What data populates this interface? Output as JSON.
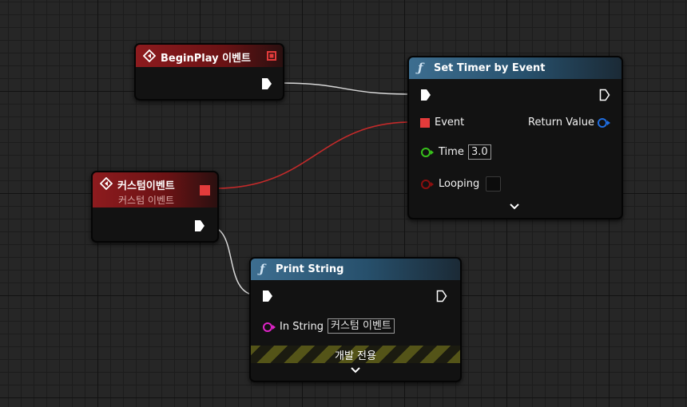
{
  "nodes": {
    "begin_play": {
      "title": "BeginPlay 이벤트"
    },
    "set_timer": {
      "title": "Set Timer by Event",
      "pins": {
        "event": "Event",
        "return_value": "Return Value",
        "time": "Time",
        "time_value": "3.0",
        "looping": "Looping"
      }
    },
    "custom_event": {
      "title": "커스텀이벤트",
      "subtitle": "커스텀 이벤트"
    },
    "print_string": {
      "title": "Print String",
      "pins": {
        "in_string": "In String",
        "in_string_value": "커스텀 이벤트"
      },
      "dev_only": "개발 전용"
    }
  },
  "colors": {
    "exec": "#ffffff",
    "delegate": "#e33b3b",
    "float": "#38c21b",
    "bool": "#8c0f0f",
    "string": "#e024c9",
    "handle": "#1f6de0"
  },
  "icons": {
    "event_node": "event-diamond-icon",
    "function_node": "function-f-icon",
    "expand": "chevron-down-icon"
  }
}
